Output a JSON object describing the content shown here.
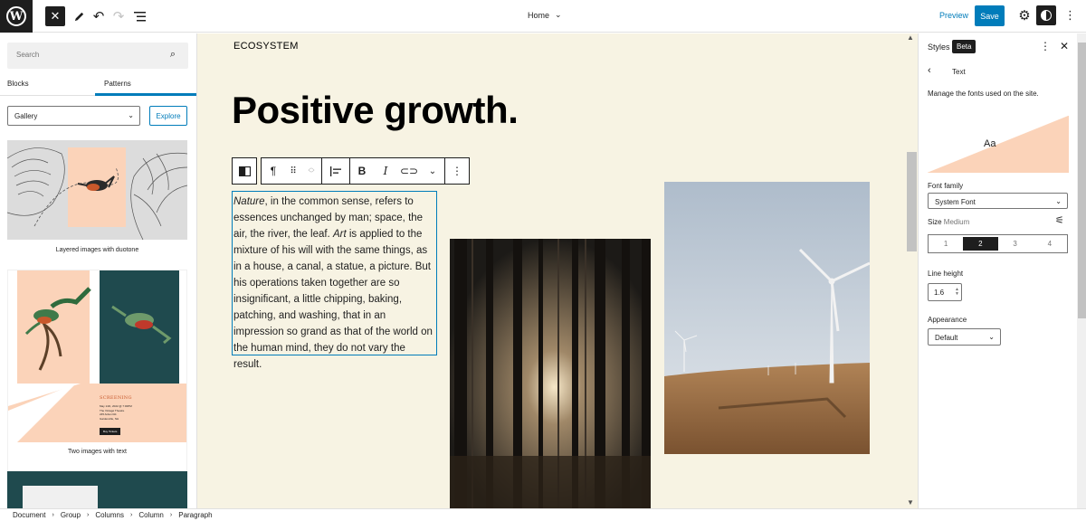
{
  "header": {
    "document_title": "Home",
    "preview_label": "Preview",
    "save_label": "Save"
  },
  "inserter": {
    "search_placeholder": "Search",
    "tabs": [
      "Blocks",
      "Patterns"
    ],
    "active_tab": "Patterns",
    "category_selected": "Gallery",
    "explore_label": "Explore",
    "patterns": [
      {
        "label": "Layered images with duotone"
      },
      {
        "label": "Two images with text",
        "poster_title": "SCREENING",
        "poster_details": "May 14th, 2022 @ 7:00PM\nThe Vintagé Theatre\n245 Arden Rd.\nGardenville, NH",
        "poster_button": "Buy Tickets"
      }
    ]
  },
  "canvas": {
    "site_title": "ECOSYSTEM",
    "headline": "Positive growth.",
    "paragraph_em1": "Nature",
    "paragraph_part1": ", in the common sense, refers to essences unchanged by man; space, the air, the river, the leaf. ",
    "paragraph_em2": "Art",
    "paragraph_part2": " is applied to the mixture of his will with the same things, as in a house, a canal, a statue, a picture. But his operations taken together are so insignificant, a little chipping, baking, patching, and washing, that in an impression so grand as that of the world on the human mind, they do not vary the result."
  },
  "styles_panel": {
    "title": "Styles",
    "beta_label": "Beta",
    "section": "Text",
    "description": "Manage the fonts used on the site.",
    "preview_text": "Aa",
    "font_family_label": "Font family",
    "font_family_value": "System Font",
    "size_label": "Size",
    "size_value": "Medium",
    "size_options": [
      "1",
      "2",
      "3",
      "4"
    ],
    "size_selected": "2",
    "line_height_label": "Line height",
    "line_height_value": "1.6",
    "appearance_label": "Appearance",
    "appearance_value": "Default"
  },
  "breadcrumb": [
    "Document",
    "Group",
    "Columns",
    "Column",
    "Paragraph"
  ],
  "colors": {
    "accent": "#007cba",
    "canvas_bg": "#f7f3e3",
    "duotone_peach": "#fbd3b9",
    "dark_teal": "#1f4a4e"
  }
}
